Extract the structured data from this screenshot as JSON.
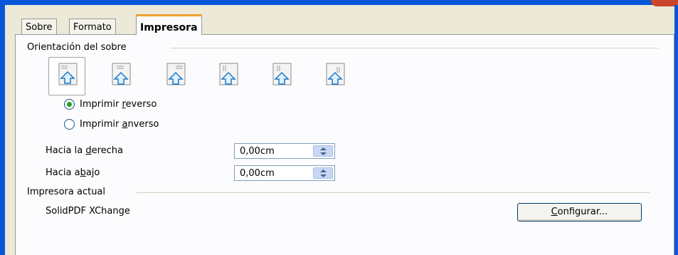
{
  "tabs": [
    {
      "label": "Sobre",
      "active": false
    },
    {
      "label": "Formato",
      "active": false
    },
    {
      "label": "Impresora",
      "active": true
    }
  ],
  "orientation": {
    "title": "Orientación del sobre",
    "options": [
      {
        "icon": "envelope-orientation-horizontal-left-icon",
        "selected": true
      },
      {
        "icon": "envelope-orientation-horizontal-center-icon",
        "selected": false
      },
      {
        "icon": "envelope-orientation-horizontal-right-icon",
        "selected": false
      },
      {
        "icon": "envelope-orientation-vertical-left-icon",
        "selected": false
      },
      {
        "icon": "envelope-orientation-vertical-center-icon",
        "selected": false
      },
      {
        "icon": "envelope-orientation-vertical-right-icon",
        "selected": false
      }
    ],
    "print_reverse": {
      "label_pre": "Imprimir ",
      "label_mnemonic": "r",
      "label_post": "everso",
      "checked": true
    },
    "print_front": {
      "label_pre": "Imprimir ",
      "label_mnemonic": "a",
      "label_post": "nverso",
      "checked": false
    }
  },
  "offsets": {
    "right": {
      "label_pre": "Hacia la ",
      "label_mnemonic": "d",
      "label_post": "erecha",
      "value": "0,00cm"
    },
    "down": {
      "label_pre": "Hacia a",
      "label_mnemonic": "b",
      "label_post": "ajo",
      "value": "0,00cm"
    }
  },
  "current_printer": {
    "title": "Impresora actual",
    "name": "SolidPDF XChange",
    "configure_mnemonic": "C",
    "configure_rest": "onfigurar..."
  },
  "colors": {
    "window_frame": "#0a56d8",
    "active_tab_accent": "#f0a232",
    "radio_selected": "#21a121",
    "arrow_blue": "#1e78c8"
  }
}
